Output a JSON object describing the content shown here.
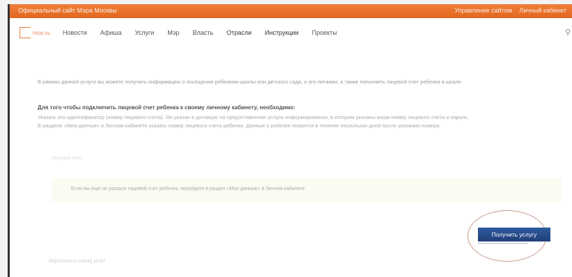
{
  "topbar": {
    "site_title": "Официальный сайт Мэра Москвы",
    "link_1": "Управление сайтом",
    "link_2": "Личный кабинет"
  },
  "nav": {
    "logo_text": "mos.ru",
    "items": [
      "Новости",
      "Афиша",
      "Услуги",
      "Мэр",
      "Власть",
      "Отрасли",
      "Инструкции",
      "Проекты"
    ]
  },
  "content": {
    "intro": "В рамках данной услуги вы можете получить информацию о посещении ребенком школы или детского сада, о его питании, а также пополнить лицевой счет ребенка в школе.",
    "howto_title": "Для того чтобы подключить лицевой счет ребенка к своему личному кабинету, необходимо:",
    "howto_line_1": "Указать его идентификатор (номер лицевого счета). Он указан в договоре на предоставление услуги информирования, в котором указаны ваши номер лицевого счета и пароль.",
    "howto_line_2": "В разделе «Мои данные» в Личном кабинете указать номер лицевого счета ребенка. Данные о ребенке появятся в течение нескольких дней после указания номера.",
    "field_label": "Лицевой счет",
    "notice": "Если вы еще не указали лицевой счет ребенка, перейдите в раздел «Мои данные» в Личном кабинете",
    "service_button": "Получить услугу",
    "bottom_link": "Вернуться к списку услуг"
  }
}
